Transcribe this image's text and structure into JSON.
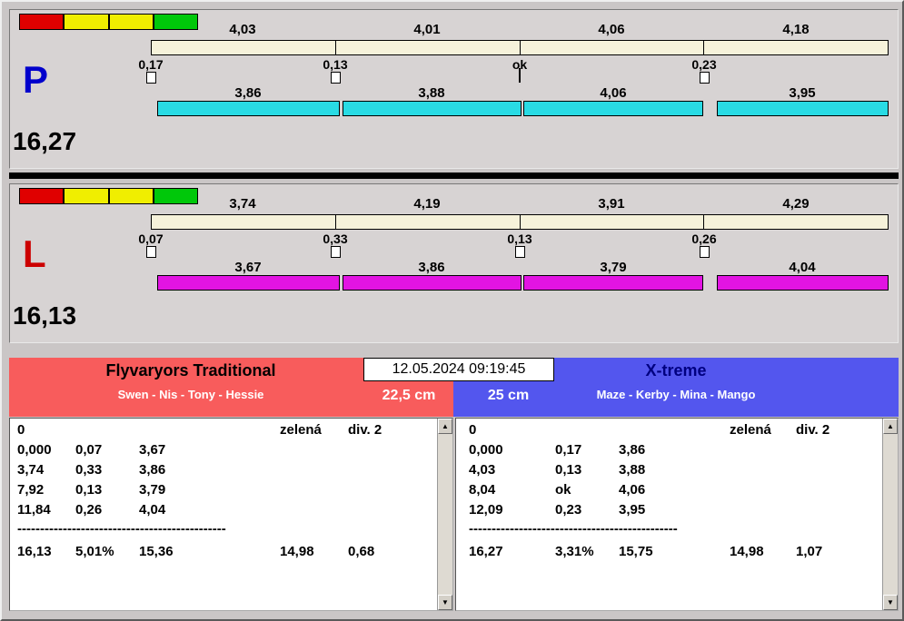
{
  "lanes": [
    {
      "letter": "P",
      "total": "16,27",
      "segments": [
        "4,03",
        "4,01",
        "4,06",
        "4,18"
      ],
      "splits": [
        "0,17",
        "0,13",
        "ok",
        "0,23"
      ],
      "runs": [
        "3,86",
        "3,88",
        "4,06",
        "3,95"
      ]
    },
    {
      "letter": "L",
      "total": "16,13",
      "segments": [
        "3,74",
        "4,19",
        "3,91",
        "4,29"
      ],
      "splits": [
        "0,07",
        "0,33",
        "0,13",
        "0,26"
      ],
      "runs": [
        "3,67",
        "3,86",
        "3,79",
        "4,04"
      ]
    }
  ],
  "header": {
    "datetime": "12.05.2024 09:19:45",
    "teams": [
      {
        "name": "Flyvaryors Traditional",
        "members": "Swen - Nis - Tony - Hessie",
        "jump_height": "22,5 cm"
      },
      {
        "name": "X-treme",
        "members": "Maze - Kerby - Mina - Mango",
        "jump_height": "25 cm"
      }
    ]
  },
  "tables": [
    {
      "start": "0",
      "light": "zelená",
      "division": "div. 2",
      "rows": [
        [
          "0,000",
          "0,07",
          "3,67"
        ],
        [
          "3,74",
          "0,33",
          "3,86"
        ],
        [
          "7,92",
          "0,13",
          "3,79"
        ],
        [
          "11,84",
          "0,26",
          "4,04"
        ]
      ],
      "divider": "----------------------------------------------",
      "summary": [
        "16,13",
        "5,01%",
        "15,36",
        "14,98",
        "0,68"
      ]
    },
    {
      "start": "0",
      "light": "zelená",
      "division": "div. 2",
      "rows": [
        [
          "0,000",
          "0,17",
          "3,86"
        ],
        [
          "4,03",
          "0,13",
          "3,88"
        ],
        [
          "8,04",
          "ok",
          "4,06"
        ],
        [
          "12,09",
          "0,23",
          "3,95"
        ]
      ],
      "divider": "----------------------------------------------",
      "summary": [
        "16,27",
        "3,31%",
        "15,75",
        "14,98",
        "1,07"
      ]
    }
  ],
  "icons": {
    "scroll_up": "▲",
    "scroll_down": "▼"
  },
  "colors": {
    "p_letter": "#0000cc",
    "l_letter": "#cc0000",
    "p_run_bar": "#29dbe4",
    "l_run_bar": "#e214e2",
    "segment_bar": "#f6f2da",
    "team_left_bg": "#f85c5c",
    "team_right_bg": "#5356ee",
    "gauge": [
      "#e00000",
      "#f0ee00",
      "#f0ee00",
      "#00c80a"
    ]
  }
}
